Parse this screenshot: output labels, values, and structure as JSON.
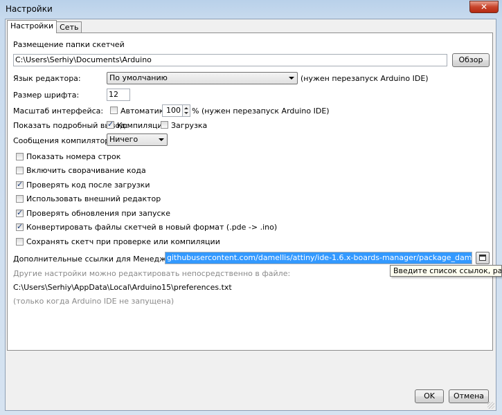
{
  "window": {
    "title": "Настройки",
    "close_glyph": "✕"
  },
  "tabs": [
    {
      "label": "Настройки"
    },
    {
      "label": "Сеть"
    }
  ],
  "sketchbook": {
    "label": "Размещение папки скетчей",
    "path": "C:\\Users\\Serhiy\\Documents\\Arduino",
    "browse_label": "Обзор"
  },
  "editor_language": {
    "label": "Язык редактора:",
    "value": "По умолчанию",
    "note": "(нужен перезапуск Arduino IDE)"
  },
  "font_size": {
    "label": "Размер шрифта:",
    "value": "12"
  },
  "interface_scale": {
    "label": "Масштаб интерфейса:",
    "auto_label": "Автоматика",
    "value": "100",
    "percent": "%",
    "note": "(нужен перезапуск Arduino IDE)"
  },
  "verbose_output": {
    "label": "Показать подробный вывод:",
    "compile_label": "Компиляция",
    "upload_label": "Загрузка"
  },
  "compiler_warnings": {
    "label": "Сообщения компилятора:",
    "value": "Ничего"
  },
  "options": [
    {
      "label": "Показать номера строк",
      "checked": false
    },
    {
      "label": "Включить сворачивание кода",
      "checked": false
    },
    {
      "label": "Проверять код после загрузки",
      "checked": true
    },
    {
      "label": "Использовать внешний редактор",
      "checked": false
    },
    {
      "label": "Проверять обновления при запуске",
      "checked": true
    },
    {
      "label": "Конвертировать файлы скетчей в новый формат (.pde -> .ino)",
      "checked": true
    },
    {
      "label": "Сохранять скетч при проверке или компиляции",
      "checked": false
    }
  ],
  "board_urls": {
    "label": "Дополнительные ссылки для Менеджера плат:",
    "value": "githubusercontent.com/damellis/attiny/ide-1.6.x-boards-manager/package_damellis_attiny_index.json",
    "icon": "window-icon"
  },
  "tooltip": "Введите список ссылок, разделё",
  "prefs_info": {
    "more_label": "Другие настройки можно редактировать непосредственно в файле:",
    "path": "C:\\Users\\Serhiy\\AppData\\Local\\Arduino15\\preferences.txt",
    "note": "(только когда Arduino IDE не запущена)"
  },
  "footer": {
    "ok_label": "OK",
    "cancel_label": "Отмена"
  }
}
